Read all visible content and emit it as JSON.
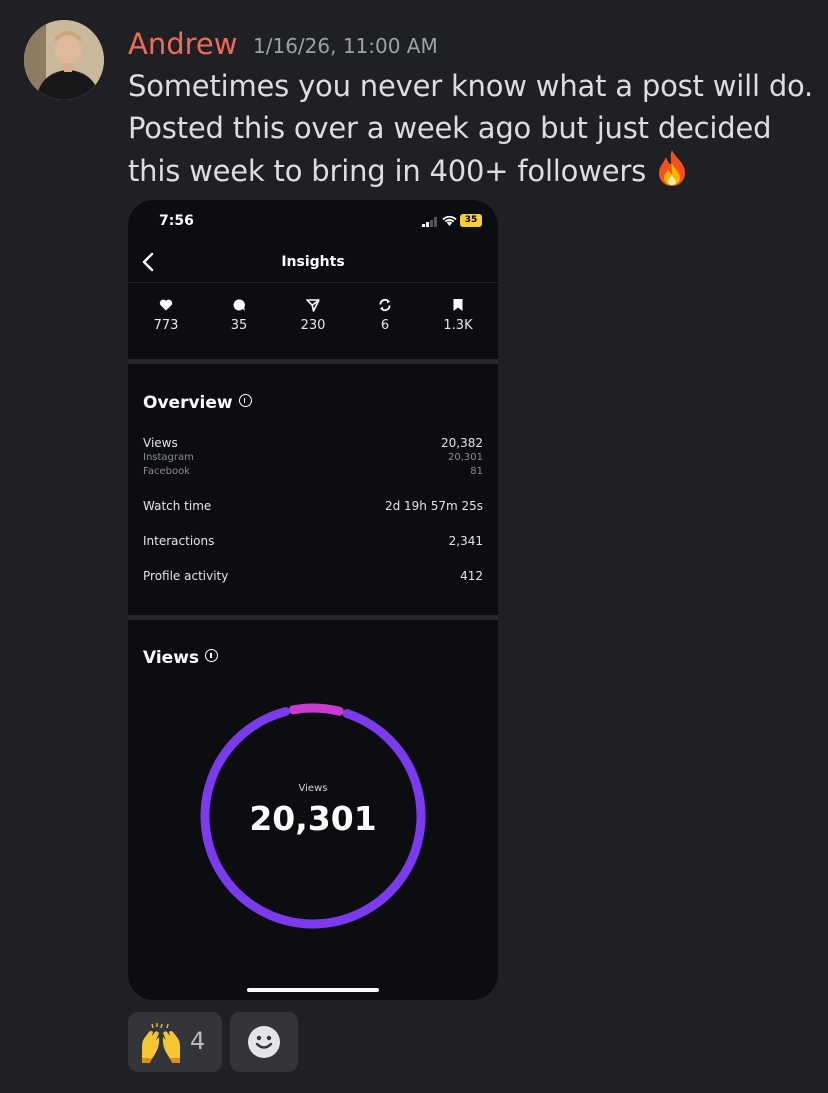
{
  "message": {
    "author": "Andrew",
    "timestamp": "1/16/26, 11:00 AM",
    "text": "Sometimes you never know what a post will do. Posted this over a week ago but just decided this week to bring in 400+ followers"
  },
  "phone": {
    "status_time": "7:56",
    "battery": "35",
    "title": "Insights",
    "stats": [
      {
        "icon": "heart-icon",
        "value": "773"
      },
      {
        "icon": "comment-icon",
        "value": "35"
      },
      {
        "icon": "share-icon",
        "value": "230"
      },
      {
        "icon": "repost-icon",
        "value": "6"
      },
      {
        "icon": "bookmark-icon",
        "value": "1.3K"
      }
    ],
    "overview": {
      "title": "Overview",
      "rows": [
        {
          "label": "Views",
          "value": "20,382"
        },
        {
          "label": "Instagram",
          "value": "20,301"
        },
        {
          "label": "Facebook",
          "value": "81"
        },
        {
          "label": "Watch time",
          "value": "2d 19h 57m 25s"
        },
        {
          "label": "Interactions",
          "value": "2,341"
        },
        {
          "label": "Profile activity",
          "value": "412"
        }
      ]
    },
    "views": {
      "title": "Views",
      "ring_label": "Views",
      "ring_value": "20,301",
      "segments": [
        {
          "color": "#7c3aed",
          "fraction": 0.92
        },
        {
          "color": "#c93ad0",
          "fraction": 0.08
        }
      ]
    }
  },
  "reactions": [
    {
      "emoji": "raising-hands-icon",
      "count": "4"
    },
    {
      "emoji": "add-reaction-icon",
      "count": ""
    }
  ],
  "colors": {
    "author": "#ef6a5a",
    "background": "#1f2024",
    "ring_primary": "#7c3aed",
    "ring_accent": "#c93ad0"
  }
}
